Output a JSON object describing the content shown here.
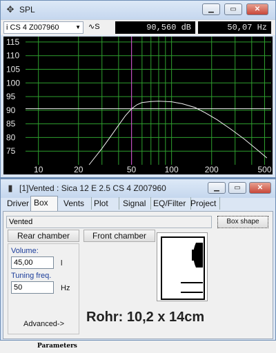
{
  "spl_window": {
    "title": "SPL",
    "driver_select": "i CS 4 Z007960",
    "mode_label": "S",
    "db_readout": "90,560 dB",
    "hz_readout": "50,07 Hz",
    "y_ticks": [
      "115",
      "110",
      "105",
      "100",
      "95",
      "90",
      "85",
      "80",
      "75"
    ],
    "x_ticks": [
      "10",
      "20",
      "50",
      "100",
      "200",
      "500"
    ]
  },
  "chart_data": {
    "type": "line",
    "xscale": "log",
    "xlim": [
      8,
      560
    ],
    "ylim": [
      70,
      117
    ],
    "reference_line_y": 90.56,
    "cursor_x": 50.07,
    "grid": true,
    "series": [
      {
        "x": [
          24,
          30,
          35,
          40,
          45,
          50,
          55,
          60,
          70,
          80,
          100,
          120,
          150,
          180,
          220,
          280,
          350,
          440,
          520
        ],
        "y": [
          70,
          76,
          80.5,
          84.5,
          88,
          90.5,
          92,
          92.8,
          93.2,
          93.3,
          93.1,
          92.4,
          91,
          89,
          86.5,
          83,
          79.5,
          75.5,
          72.5
        ]
      }
    ],
    "colors": {
      "grid": "#2ea02e",
      "curve": "#f2f2f2",
      "ref_line": "#f2f2f2",
      "cursor": "#e040e0"
    }
  },
  "box_window": {
    "title": "[1]Vented : Sica 12 E 2.5 CS 4 Z007960",
    "tabs": [
      "Driver",
      "Box",
      "Vents",
      "Plot",
      "Signal",
      "EQ/Filter",
      "Project"
    ],
    "active_tab": "Box",
    "box_type": "Vented",
    "box_shape_button": "Box shape",
    "rear_chamber_button": "Rear chamber",
    "front_chamber_button": "Front chamber",
    "volume_label": "Volume:",
    "volume_value": "45,00",
    "volume_unit": "l",
    "tuning_label": "Tuning freq.",
    "tuning_value": "50",
    "tuning_unit": "Hz",
    "advanced_button": "Advanced->",
    "annotation": "Rohr: 10,2 x 14cm",
    "status": "Parameters"
  }
}
